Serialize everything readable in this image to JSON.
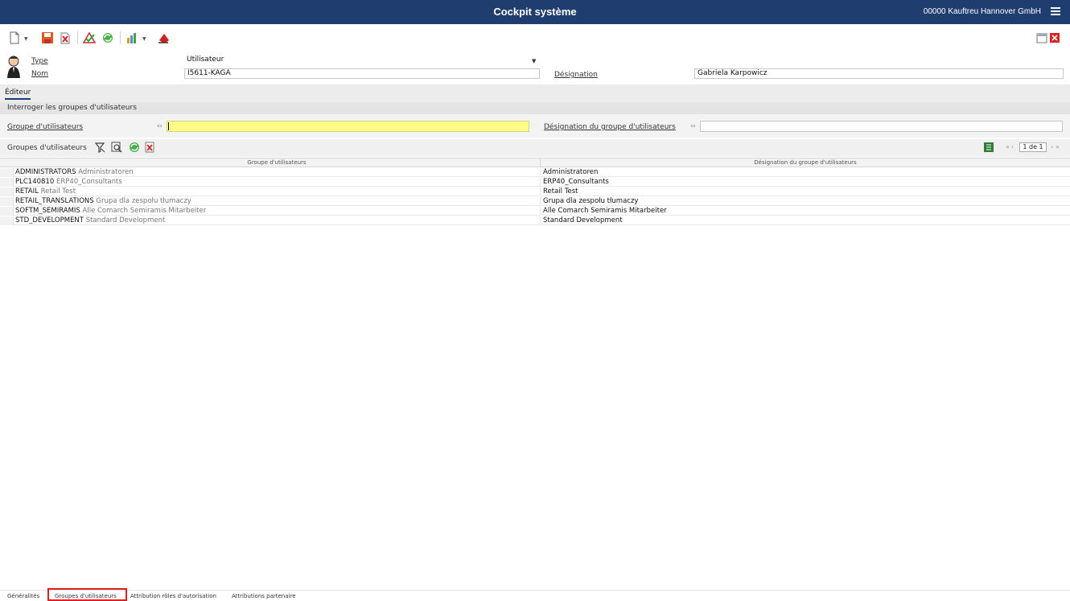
{
  "titlebar": {
    "title": "Cockpit système",
    "company": "00000  Kauftreu Hannover GmbH",
    "menu_icon": "hamburger-icon"
  },
  "toolbar": {
    "icons": [
      "new-icon",
      "dropdown-icon",
      "save-icon",
      "delete-icon",
      "validate-icon",
      "refresh-icon",
      "report-icon",
      "dropdown-icon",
      "clear-icon",
      "window-icon",
      "close-icon"
    ]
  },
  "header": {
    "type_label": "Type",
    "type_value": "Utilisateur",
    "nom_label": "Nom",
    "nom_value": "I5611-KAGA",
    "designation_label": "Désignation",
    "designation_value": "Gabriela Karpowicz"
  },
  "editor_tab": "Éditeur",
  "query_section": "Interroger les groupes d'utilisateurs",
  "filters": {
    "group_label": "Groupe d'utilisateurs",
    "group_value": "",
    "designation_label": "Désignation du groupe d'utilisateurs",
    "designation_value": ""
  },
  "grid": {
    "title": "Groupes d'utilisateurs",
    "pager_text": "1 de 1",
    "columns": [
      "Groupe d'utilisateurs",
      "Désignation du groupe d'utilisateurs"
    ],
    "rows": [
      {
        "code": "ADMINISTRATORS",
        "desc": "Administratoren",
        "designation": "Administratoren"
      },
      {
        "code": "PLC140810",
        "desc": "ERP40_Consultants",
        "designation": "ERP40_Consultants"
      },
      {
        "code": "RETAIL",
        "desc": "Retail Test",
        "designation": "Retail Test"
      },
      {
        "code": "RETAIL_TRANSLATIONS",
        "desc": "Grupa dla zespołu tłumaczy",
        "designation": "Grupa dla zespołu tłumaczy"
      },
      {
        "code": "SOFTM_SEMIRAMIS",
        "desc": "Alle Comarch Semiramis  Mitarbeiter",
        "designation": "Alle Comarch Semiramis  Mitarbeiter"
      },
      {
        "code": "STD_DEVELOPMENT",
        "desc": "Standard Development",
        "designation": "Standard Development"
      }
    ]
  },
  "bottom_tabs": [
    "Généralités",
    "Groupes d'utilisateurs",
    "Attribution rôles d'autorisation",
    "Attributions partenaire"
  ],
  "colors": {
    "titlebar": "#1f3e6f",
    "highlight": "#ffff88",
    "active_tab_border": "#e02020"
  }
}
